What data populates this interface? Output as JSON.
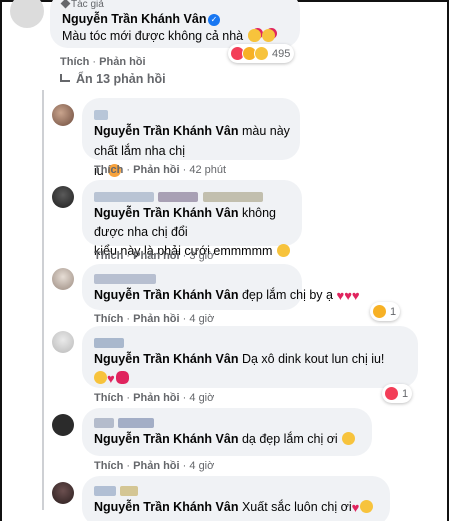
{
  "top": {
    "badge_label": "Tác giả",
    "author": "Nguyễn Trần Khánh Vân",
    "text": "Màu tóc mới được không cả nhà",
    "actions": {
      "like": "Thích",
      "dot": "·",
      "reply": "Phản hồi"
    },
    "reaction_count": "495"
  },
  "hide_replies_label": "Ẩn 13 phản hồi",
  "replies": [
    {
      "author": "Nguyễn Trần Khánh Vân",
      "text_line1": "màu này chất lắm nha chị",
      "text_line2": "iu",
      "like": "Thích",
      "dot": "·",
      "reply": "Phản hồi",
      "time": "42 phút"
    },
    {
      "author": "Nguyễn Trần Khánh Vân",
      "text_line1": "không được nha chị đổi",
      "text_line2": "kiểu này là phải cưới emmmmm",
      "like": "Thích",
      "dot": "·",
      "reply": "Phản hồi",
      "time": "3 giờ"
    },
    {
      "author": "Nguyễn Trần Khánh Vân",
      "text_line1": "đẹp lắm chị by ạ",
      "like": "Thích",
      "dot": "·",
      "reply": "Phản hồi",
      "time": "4 giờ",
      "reaction_count": "1"
    },
    {
      "author": "Nguyễn Trần Khánh Vân",
      "text_line1": "Dạ xô dink kout lun chị iu!",
      "like": "Thích",
      "dot": "·",
      "reply": "Phản hồi",
      "time": "4 giờ",
      "reaction_count": "1"
    },
    {
      "author": "Nguyễn Trần Khánh Vân",
      "text_line1": "dạ đẹp lắm chị ơi",
      "like": "Thích",
      "dot": "·",
      "reply": "Phản hồi",
      "time": "4 giờ"
    },
    {
      "author": "Nguyễn Trần Khánh Vân",
      "text_line1": "Xuất sắc luôn chị ơi"
    }
  ],
  "colors": {
    "bubble": "#f0f2f5",
    "meta_text": "#65676b",
    "verified_blue": "#1877f2",
    "heart_red": "#e0245e",
    "emoji_yellow": "#f7c33c"
  }
}
